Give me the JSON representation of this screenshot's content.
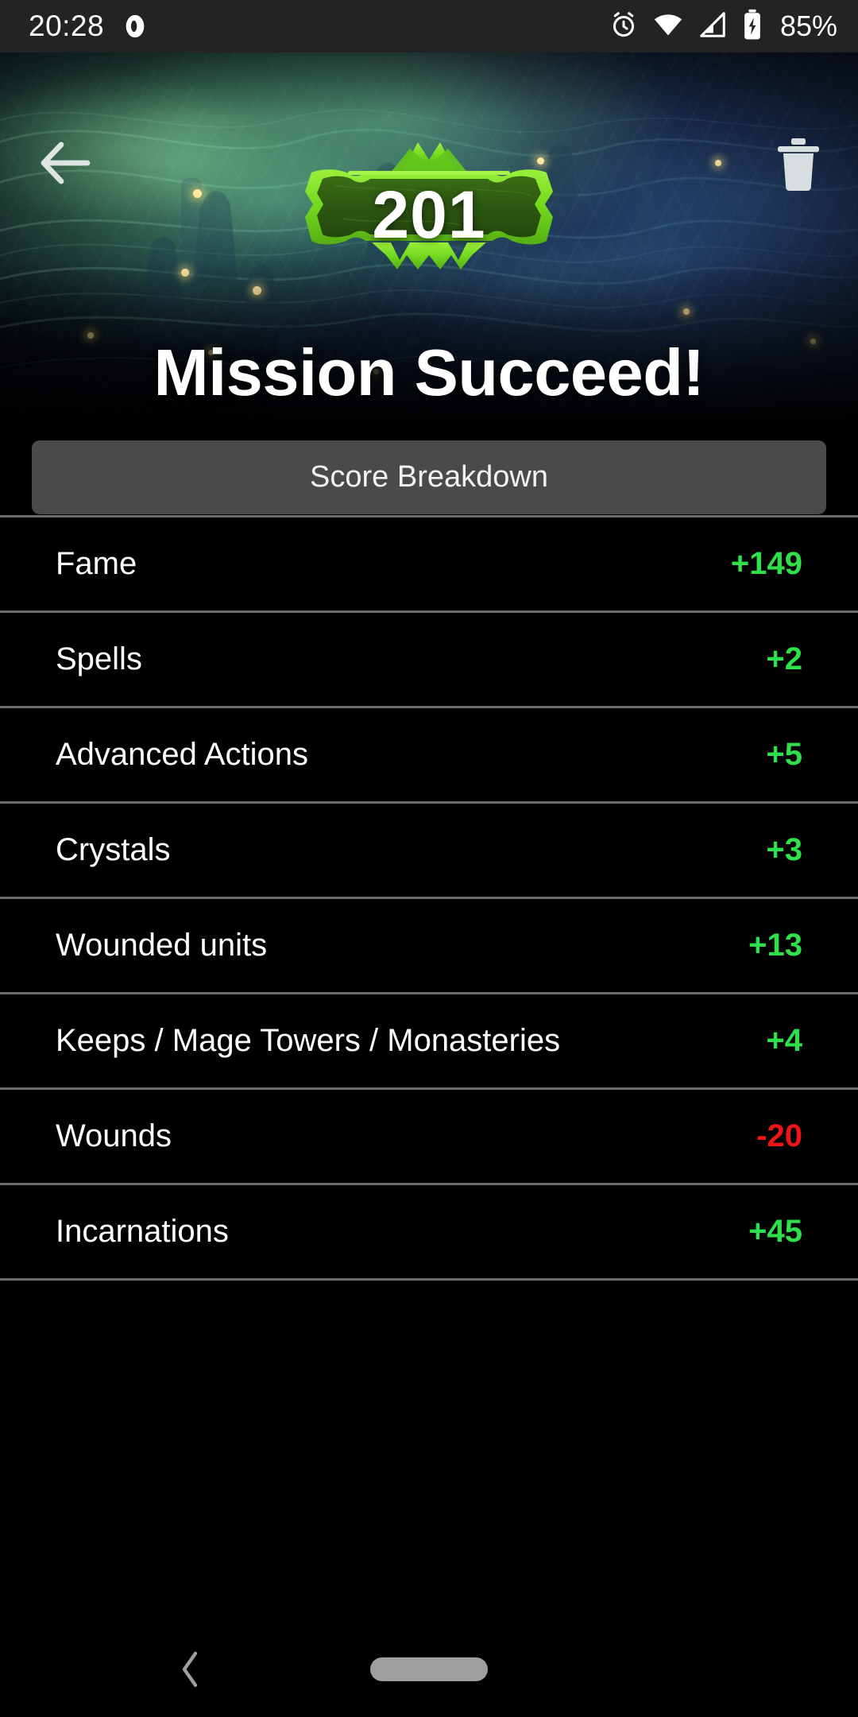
{
  "status_bar": {
    "time": "20:28",
    "battery_percent": "85%",
    "icons": [
      "notification-dot-icon",
      "alarm-icon",
      "wifi-icon",
      "cellular-signal-icon",
      "battery-charging-icon"
    ]
  },
  "hero": {
    "score": "201",
    "title": "Mission Succeed!",
    "back_icon": "back-arrow-icon",
    "delete_icon": "trash-icon",
    "badge_edge_color": "#7ce02a",
    "badge_fill_color": "#2f5a12"
  },
  "breakdown": {
    "header_label": "Score Breakdown",
    "positive_color": "#2fe04a",
    "negative_color": "#f01414",
    "rows": [
      {
        "label": "Fame",
        "value": "+149",
        "sign": "pos"
      },
      {
        "label": "Spells",
        "value": "+2",
        "sign": "pos"
      },
      {
        "label": "Advanced Actions",
        "value": "+5",
        "sign": "pos"
      },
      {
        "label": "Crystals",
        "value": "+3",
        "sign": "pos"
      },
      {
        "label": "Wounded units",
        "value": "+13",
        "sign": "pos"
      },
      {
        "label": "Keeps / Mage Towers / Monasteries",
        "value": "+4",
        "sign": "pos"
      },
      {
        "label": "Wounds",
        "value": "-20",
        "sign": "neg"
      },
      {
        "label": "Incarnations",
        "value": "+45",
        "sign": "pos"
      }
    ]
  },
  "nav_bar": {
    "back_icon": "nav-back-chevron-icon",
    "home_icon": "nav-home-pill-icon"
  }
}
